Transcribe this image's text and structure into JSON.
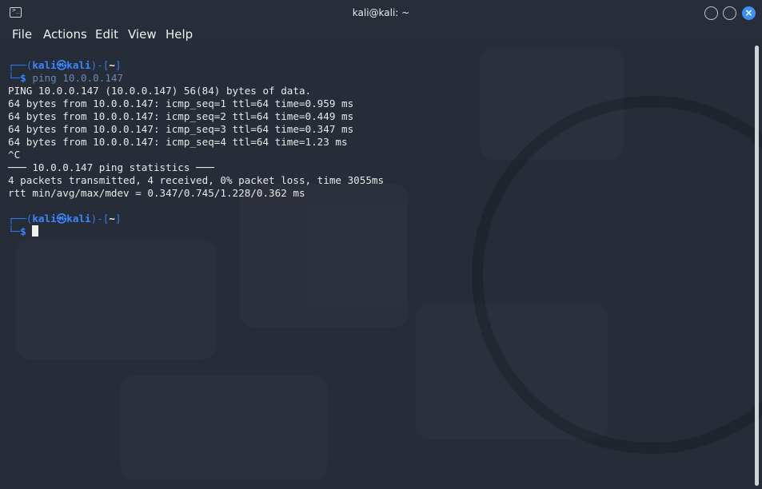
{
  "window": {
    "title": "kali@kali: ~",
    "close_glyph": "×"
  },
  "menu": {
    "items": [
      "File",
      "Actions",
      "Edit",
      "View",
      "Help"
    ]
  },
  "terminal": {
    "prompt1": {
      "user": "kali",
      "at": "㉿",
      "host": "kali",
      "dir": "~",
      "dollar": "$",
      "command": "ping 10.0.0.147"
    },
    "output": [
      "PING 10.0.0.147 (10.0.0.147) 56(84) bytes of data.",
      "64 bytes from 10.0.0.147: icmp_seq=1 ttl=64 time=0.959 ms",
      "64 bytes from 10.0.0.147: icmp_seq=2 ttl=64 time=0.449 ms",
      "64 bytes from 10.0.0.147: icmp_seq=3 ttl=64 time=0.347 ms",
      "64 bytes from 10.0.0.147: icmp_seq=4 ttl=64 time=1.23 ms",
      "^C",
      "─── 10.0.0.147 ping statistics ───",
      "4 packets transmitted, 4 received, 0% packet loss, time 3055ms",
      "rtt min/avg/max/mdev = 0.347/0.745/1.228/0.362 ms"
    ],
    "prompt2": {
      "user": "kali",
      "at": "㉿",
      "host": "kali",
      "dir": "~",
      "dollar": "$"
    }
  },
  "colors": {
    "background": "#262c38",
    "prompt_blue": "#2f7bf5",
    "close_button": "#3d8ef5"
  }
}
